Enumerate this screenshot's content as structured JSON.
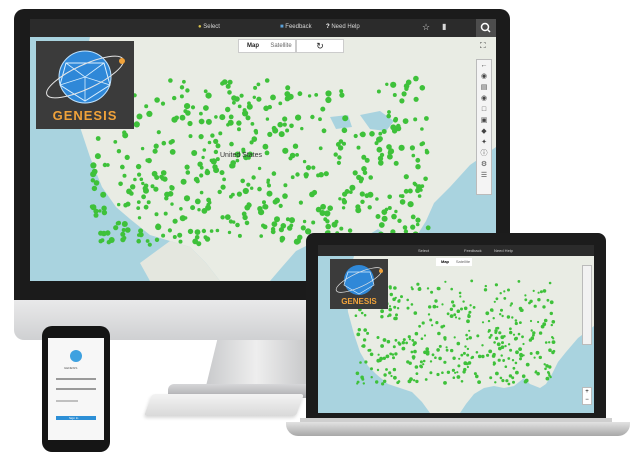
{
  "desktop": {
    "topbar": {
      "center_label": "Select",
      "feedback_label": "Feedback",
      "help_label": "Need Help",
      "icons": [
        "star-icon",
        "bookmark-icon",
        "search-icon"
      ]
    },
    "map_toggle": {
      "map_label": "Map",
      "satellite_label": "Satellite",
      "active": "Map"
    },
    "refresh_icon": "refresh-icon",
    "country_label": "United States",
    "logo_text": "GENESIS",
    "right_toolbar_icons": [
      "expand-icon",
      "arrow-icon",
      "globe-icon",
      "layers-icon",
      "pin-icon",
      "measure-icon",
      "copy-icon",
      "tag-icon",
      "info-icon",
      "settings-icon",
      "list-icon"
    ]
  },
  "laptop": {
    "topbar": {
      "center_label": "Select",
      "feedback_label": "Feedback",
      "help_label": "Need Help"
    },
    "map_toggle": {
      "map_label": "Map",
      "satellite_label": "Satellite"
    },
    "logo_text": "GENESIS"
  },
  "phone": {
    "title": "GENESIS",
    "button_label": "Sign In"
  },
  "colors": {
    "marker": "#3ec13a",
    "water": "#a9d3df",
    "land": "#e9ece4",
    "logo_accent": "#f0a23a"
  }
}
